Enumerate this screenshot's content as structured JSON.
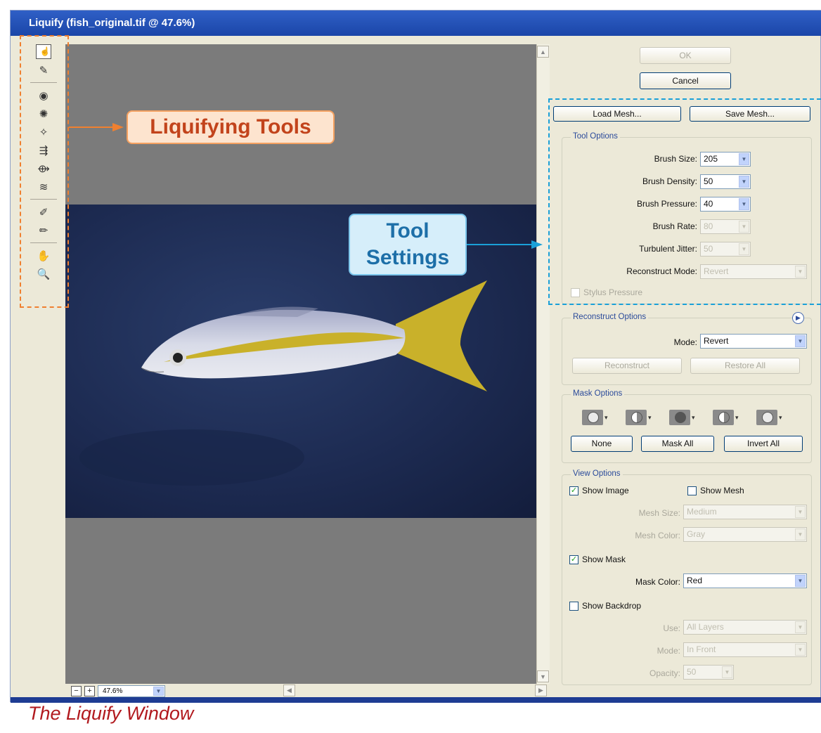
{
  "window": {
    "title": "Liquify (fish_original.tif @ 47.6%)"
  },
  "tools": [
    {
      "icon": "forward-warp-icon",
      "glyph": "☝"
    },
    {
      "icon": "reconstruct-icon",
      "glyph": "✎"
    },
    {
      "icon": "twirl-clockwise-icon",
      "glyph": "◉"
    },
    {
      "icon": "pucker-icon",
      "glyph": "✺"
    },
    {
      "icon": "bloat-icon",
      "glyph": "✧"
    },
    {
      "icon": "push-left-icon",
      "glyph": "⇶"
    },
    {
      "icon": "mirror-icon",
      "glyph": "⟴"
    },
    {
      "icon": "turbulence-icon",
      "glyph": "≋"
    },
    {
      "icon": "freeze-mask-icon",
      "glyph": "✐"
    },
    {
      "icon": "thaw-mask-icon",
      "glyph": "✏"
    },
    {
      "icon": "hand-icon",
      "glyph": "✋"
    },
    {
      "icon": "zoom-icon",
      "glyph": "🔍"
    }
  ],
  "statusbar": {
    "zoom_minus": "−",
    "zoom_plus": "+",
    "zoom_value": "47.6%"
  },
  "buttons": {
    "ok": "OK",
    "cancel": "Cancel",
    "load_mesh": "Load Mesh...",
    "save_mesh": "Save Mesh..."
  },
  "tool_options": {
    "title": "Tool Options",
    "brush_size": {
      "label": "Brush Size:",
      "value": "205"
    },
    "brush_density": {
      "label": "Brush Density:",
      "value": "50"
    },
    "brush_pressure": {
      "label": "Brush Pressure:",
      "value": "40"
    },
    "brush_rate": {
      "label": "Brush Rate:",
      "value": "80"
    },
    "turbulent_jitter": {
      "label": "Turbulent Jitter:",
      "value": "50"
    },
    "reconstruct_mode": {
      "label": "Reconstruct Mode:",
      "value": "Revert"
    },
    "stylus_pressure": "Stylus Pressure"
  },
  "reconstruct_options": {
    "title": "Reconstruct Options",
    "mode_label": "Mode:",
    "mode_value": "Revert",
    "reconstruct": "Reconstruct",
    "restore_all": "Restore All"
  },
  "mask_options": {
    "title": "Mask Options",
    "none": "None",
    "mask_all": "Mask All",
    "invert_all": "Invert All"
  },
  "view_options": {
    "title": "View Options",
    "show_image": "Show Image",
    "show_mesh": "Show Mesh",
    "mesh_size": {
      "label": "Mesh Size:",
      "value": "Medium"
    },
    "mesh_color": {
      "label": "Mesh Color:",
      "value": "Gray"
    },
    "show_mask": "Show Mask",
    "mask_color": {
      "label": "Mask Color:",
      "value": "Red"
    },
    "show_backdrop": "Show Backdrop",
    "use": {
      "label": "Use:",
      "value": "All Layers"
    },
    "mode": {
      "label": "Mode:",
      "value": "In Front"
    },
    "opacity": {
      "label": "Opacity:",
      "value": "50"
    }
  },
  "annotations": {
    "tools_callout": "Liquifying Tools",
    "settings_callout_line1": "Tool",
    "settings_callout_line2": "Settings",
    "caption": "The Liquify Window"
  },
  "colors": {
    "tools_accent": "#f08030",
    "settings_accent": "#1aa0d8",
    "caption": "#b1191e"
  }
}
